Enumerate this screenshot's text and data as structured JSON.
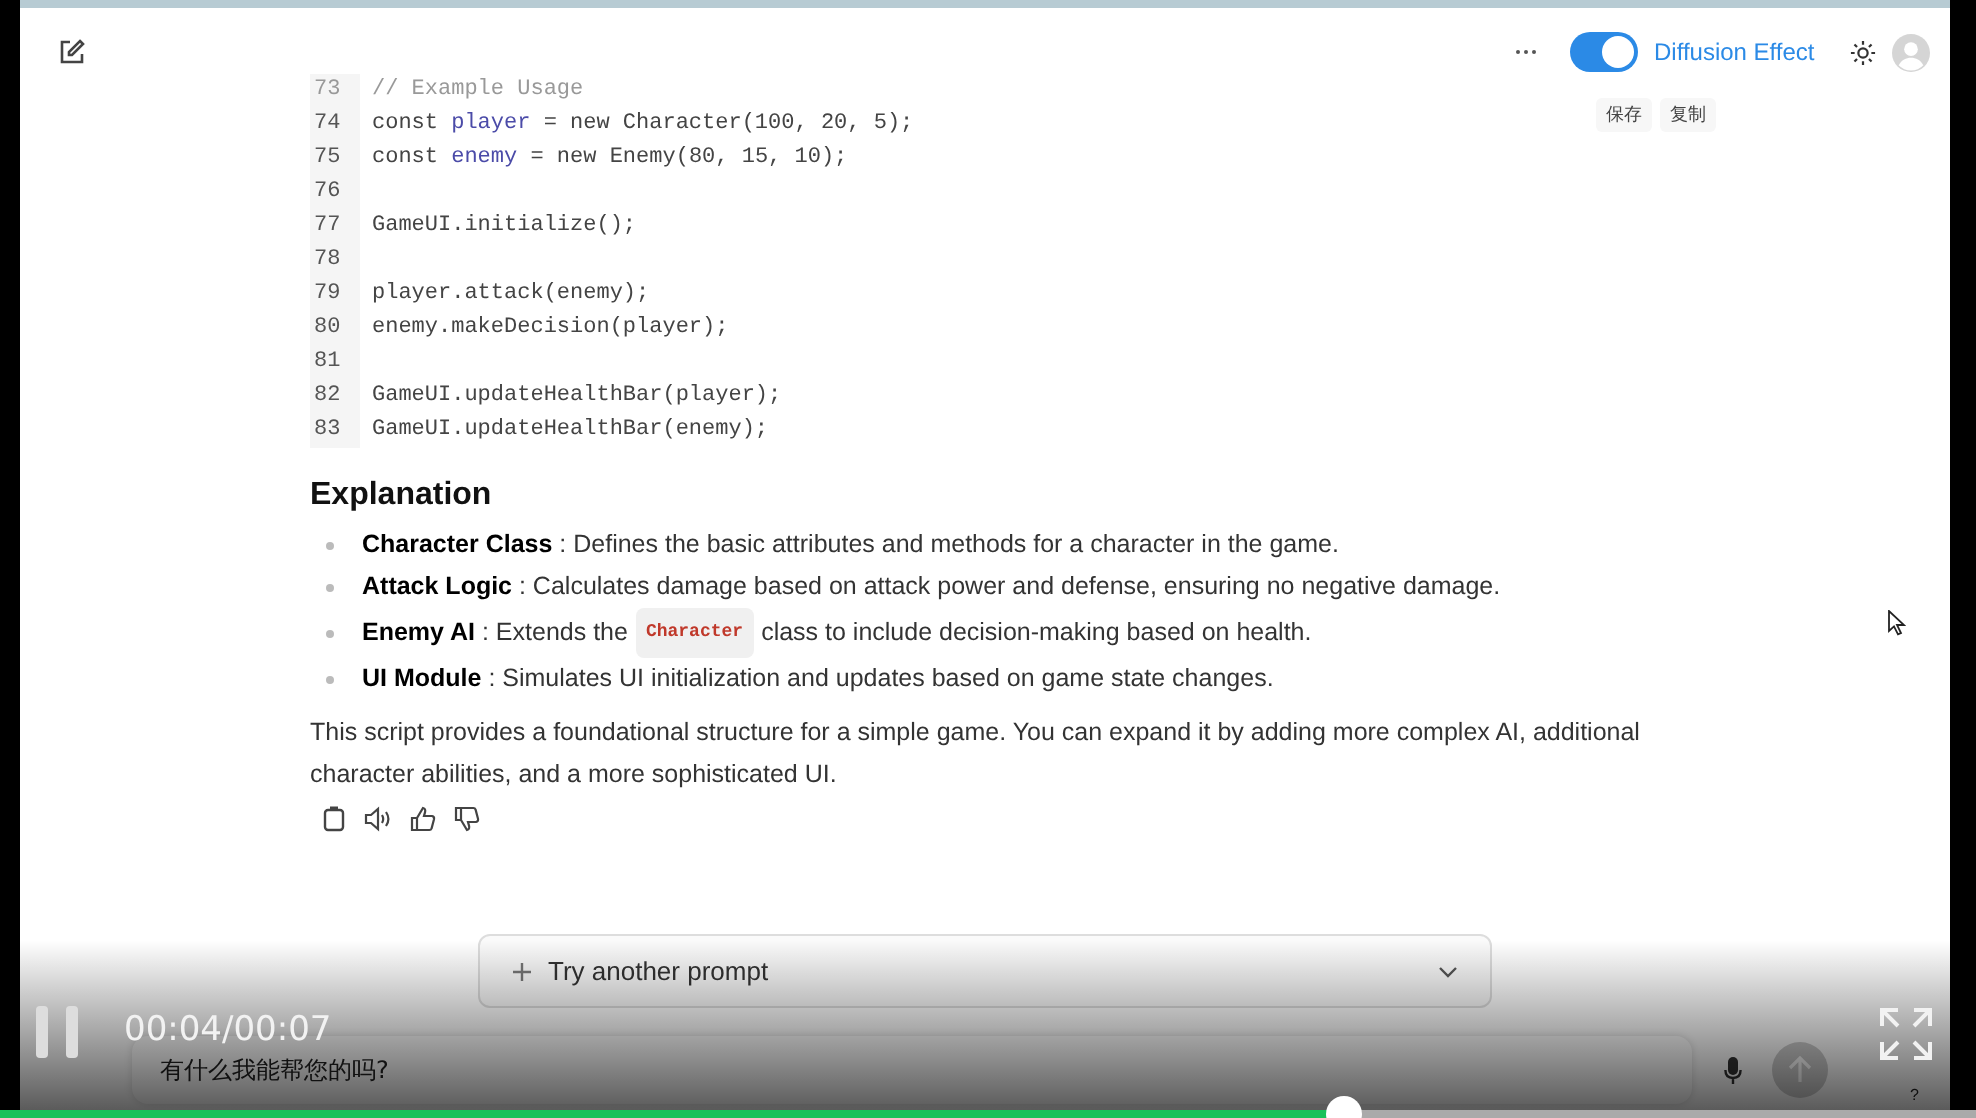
{
  "header": {
    "diffusion_toggle": {
      "label": "Diffusion Effect",
      "on": true
    },
    "code_actions": [
      "保存",
      "复制"
    ]
  },
  "code_block": {
    "lines": [
      {
        "number": "73",
        "kind": "comment",
        "parts": [
          {
            "text": "// Example Usage"
          }
        ]
      },
      {
        "number": "74",
        "kind": "code",
        "parts": [
          {
            "text": "const "
          },
          {
            "text": "player",
            "kind": "var"
          },
          {
            "text": " = new Character(100, 20, 5);"
          }
        ]
      },
      {
        "number": "75",
        "kind": "code",
        "parts": [
          {
            "text": "const "
          },
          {
            "text": "enemy",
            "kind": "var"
          },
          {
            "text": " = new Enemy(80, 15, 10);"
          }
        ]
      },
      {
        "number": "76",
        "kind": "blank"
      },
      {
        "number": "77",
        "kind": "code",
        "parts": [
          {
            "text": "GameUI.initialize();"
          }
        ]
      },
      {
        "number": "78",
        "kind": "blank"
      },
      {
        "number": "79",
        "kind": "code",
        "parts": [
          {
            "text": "player.attack(enemy);"
          }
        ]
      },
      {
        "number": "80",
        "kind": "code",
        "parts": [
          {
            "text": "enemy.makeDecision(player);"
          }
        ]
      },
      {
        "number": "81",
        "kind": "blank"
      },
      {
        "number": "82",
        "kind": "code",
        "parts": [
          {
            "text": "GameUI.updateHealthBar(player);"
          }
        ]
      },
      {
        "number": "83",
        "kind": "code",
        "parts": [
          {
            "text": "GameUI.updateHealthBar(enemy);"
          }
        ]
      }
    ]
  },
  "explanation": {
    "heading": "Explanation",
    "bullets": [
      {
        "parts": [
          {
            "kind": "text",
            "text": "**Character Class** : Defines the basic attributes and methods for a character in the game."
          }
        ]
      },
      {
        "parts": [
          {
            "kind": "text",
            "text": "**Attack Logic** : Calculates damage based on attack power and defense, ensuring no negative damage."
          }
        ]
      },
      {
        "parts": [
          {
            "kind": "text",
            "text": "**Enemy AI** : Extends the"
          },
          {
            "kind": "code",
            "text": "Character"
          },
          {
            "kind": "text",
            "text": "class to include decision-making based on health."
          }
        ]
      },
      {
        "parts": [
          {
            "kind": "text",
            "text": "**UI Module** : Simulates UI initialization and updates based on game state changes."
          }
        ]
      }
    ],
    "paragraph": "This script provides a foundational structure for a simple game. You can expand it by adding more complex AI, additional character abilities, and a more sophisticated UI."
  },
  "prompt_bar": {
    "label": "Try another prompt",
    "expanded": false
  },
  "chat_input": {
    "placeholder": "有什么我能帮您的吗?"
  },
  "help_label": "?",
  "video_player": {
    "playing": true,
    "time": "00:04/00:07",
    "progress": {
      "level": 0.68
    }
  }
}
